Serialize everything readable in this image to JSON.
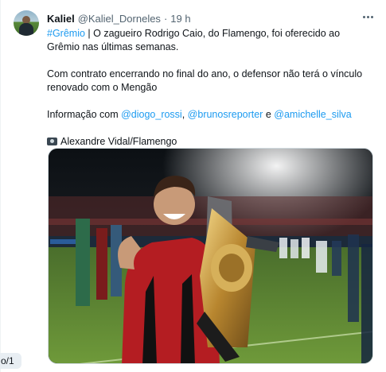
{
  "tweet": {
    "author_name": "Kaliel",
    "author_handle": "@Kaliel_Dorneles",
    "separator": "·",
    "time": "19 h",
    "paragraphs": {
      "p1_hashtag": "#Grêmio",
      "p1_text": " | O zagueiro Rodrigo Caio, do Flamengo, foi oferecido ao Grêmio nas últimas semanas.",
      "p2_text": "Com contrato encerrando no final do ano, o defensor não terá o vínculo renovado com o Mengão",
      "p3_prefix": "Informação com ",
      "p3_mention1": "@diogo_rossi",
      "p3_comma": ", ",
      "p3_mention2": "@brunosreporter",
      "p3_and": " e ",
      "p3_mention3": "@amichelle_silva",
      "photo_credit": "Alexandre Vidal/Flamengo"
    },
    "icons": {
      "more": "more-options-icon",
      "camera": "camera-icon"
    },
    "colors": {
      "link": "#1d9bf0",
      "secondary_text": "#536471"
    }
  },
  "side_pager": {
    "label": "o/1"
  }
}
